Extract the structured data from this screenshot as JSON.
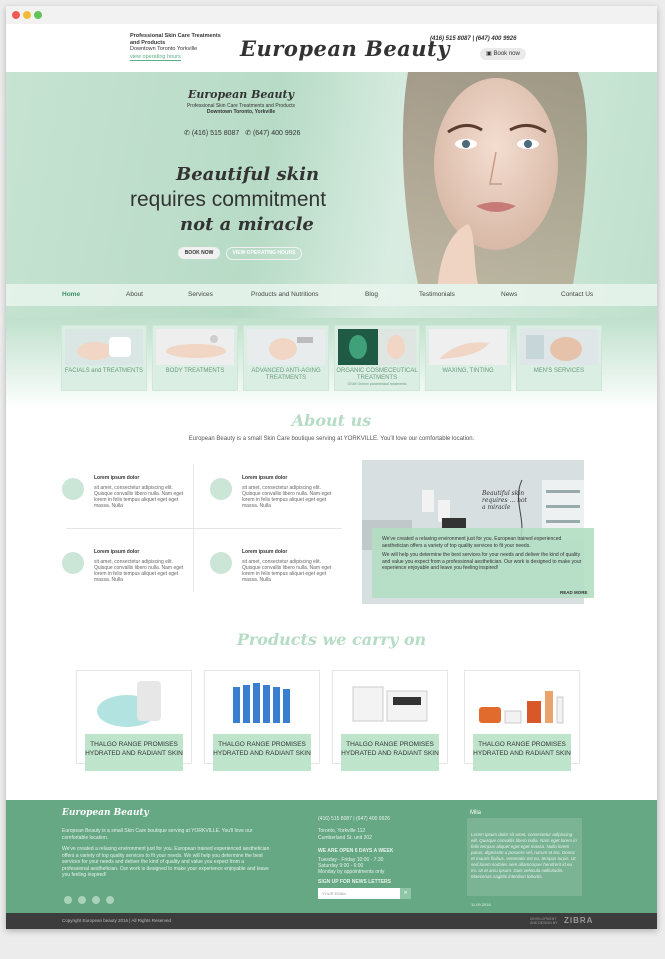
{
  "header": {
    "tagline_line1": "Professional Skin Care Treatments",
    "tagline_line2": "and Products",
    "location": "Downtown Toronto Yorkville",
    "hours_link": "view operating hours",
    "logo": "European Beauty",
    "phones": "(416) 515 8087 | (647) 400 9926",
    "book_now": "Book now"
  },
  "hero": {
    "brand": "European Beauty",
    "line1": "Professional Skin Care Treatments and Products",
    "line2": "Downtown Toronto, Yorkville",
    "phone1": "(416) 515 8087",
    "phone2": "(647) 400 9926",
    "headline1": "Beautiful skin",
    "headline2": "requires commitment",
    "headline3": "not a miracle",
    "book_button": "BOOK NOW",
    "hours_button": "VIEW OPERATING HOURS"
  },
  "nav": [
    "Home",
    "About",
    "Services",
    "Products and Nutritions",
    "Blog",
    "Testimonials",
    "News",
    "Contact Us"
  ],
  "services": [
    {
      "label": "FACIALS and TREATMENTS",
      "sub": ""
    },
    {
      "label": "BODY TREATMENTS",
      "sub": ""
    },
    {
      "label": "ADVANCED ANTI-AGING TREATMENTS",
      "sub": ""
    },
    {
      "label": "ORGANIC COSMECEUTICAL TREATMENTS",
      "sub": "OSMI Ostrom paramedical treatments"
    },
    {
      "label": "WAXING, TINTING",
      "sub": ""
    },
    {
      "label": "MEN'S SERVICES",
      "sub": ""
    }
  ],
  "about": {
    "heading": "About us",
    "subtitle": "European Beauty is a small Skin Care boutique serving at YORKVILLE. You'll love our comfortable location.",
    "features": [
      {
        "title": "Lorem ipsum dolor",
        "body": "sit amet, consectetur adipiscing elit. Quisque convallis libero nulla. Nam eget lorem in felis tempus aliquet eget eget massa. Nulla"
      },
      {
        "title": "Lorem ipsum dolor",
        "body": "sit amet, consectetur adipiscing elit. Quisque convallis libero nulla. Nam eget lorem in felis tempus aliquet eget eget massa. Nulla"
      },
      {
        "title": "Lorem ipsum dolor",
        "body": "sit amet, consectetur adipiscing elit. Quisque convallis libero nulla. Nam eget lorem in felis tempus aliquet eget eget massa. Nulla"
      },
      {
        "title": "Lorem ipsum dolor",
        "body": "sit amet, consectetur adipiscing elit. Quisque convallis libero nulla. Nam eget lorem in felis tempus aliquet eget eget massa. Nulla"
      }
    ],
    "box_p1": "We've created a relaxing environment just for you. European trained experienced aesthetician offers a variety of top quality services to fit your needs.",
    "box_p2": "We will help you determine the best services for your needs and deliver the kind of quality and value you expect from a professional aesthetician. Our work is designed to make your experience enjoyable and leave you feeling inspired!",
    "read_more": "READ MORE",
    "sign_text": "Beautiful skin requires ... not a miracle"
  },
  "products": {
    "heading": "Products we carry on",
    "items": [
      {
        "caption": "THALGO RANGE PROMISES HYDRATED AND RADIANT SKIN"
      },
      {
        "caption": "THALGO RANGE PROMISES HYDRATED AND RADIANT SKIN"
      },
      {
        "caption": "THALGO RANGE PROMISES HYDRATED AND RADIANT SKIN"
      },
      {
        "caption": "THALGO RANGE PROMISES HYDRATED AND RADIANT SKIN"
      }
    ]
  },
  "footer": {
    "brand": "European Beauty",
    "intro": "European Beauty is a small Skin Care boutique serving at YORKVILLE. You'll love our comfortable location.",
    "para": "We've created a relaxing environment just for you. European trained experienced aesthetician offers a variety of top quality services to fit your needs. We will help you determine the best services for your needs and deliver the kind of quality and value you expect from a professional aesthetician. Our work is designed to make your experience enjoyable and leave you feeling inspired!",
    "phones": "(416) 515 8087  |  (647) 400 9926",
    "address1": "Toronto, Yorkville 112",
    "address2": "Cumberland St. unit 202",
    "open_heading": "WE ARE OPEN 6 DAYS A WEEK",
    "hours1": "Tuesday - Friday 10:00 - 7:30",
    "hours2": "Saturday 9:00 - 6:00",
    "hours3": "Monday by appointments only",
    "newsletter_heading": "SIGN UP FOR NEWS LETTERS",
    "newsletter_placeholder": "YOUR EMAIL",
    "newsletter_go": "»",
    "testimonial_name": "Mila",
    "testimonial": "Lorem ipsum dolor sit amet, consectetur adipiscing elit. Quisque convallis libero nulla. Nam eget lorem in felis tempus aliquet eget eget massa. Nulla lorem purus, dignissim a posuere vel, rutrum et leo. Donec et mauris finibus, venenatis est eu, tempus turpis. Ut sed lorem sodales sem ullamcorper hendrerit id eu mi. Ut et arcu ipsum. Duis vehicula sollicitudin. Maecenas sagittis interdum lobortis.",
    "testimonial_date": "11.09.2016",
    "social_icons": [
      "facebook-icon",
      "twitter-icon",
      "youtube-icon",
      "googleplus-icon"
    ],
    "copyright": "Copyright European beauty 2016  |  All Rights Reserved",
    "developer_line1": "DEVELOPMENT",
    "developer_line2": "AND DESIGN BY",
    "developer_logo": "ZIBRA"
  },
  "colors": {
    "accent": "#66a784",
    "mint": "#bfe4cc",
    "dark": "#333333"
  }
}
